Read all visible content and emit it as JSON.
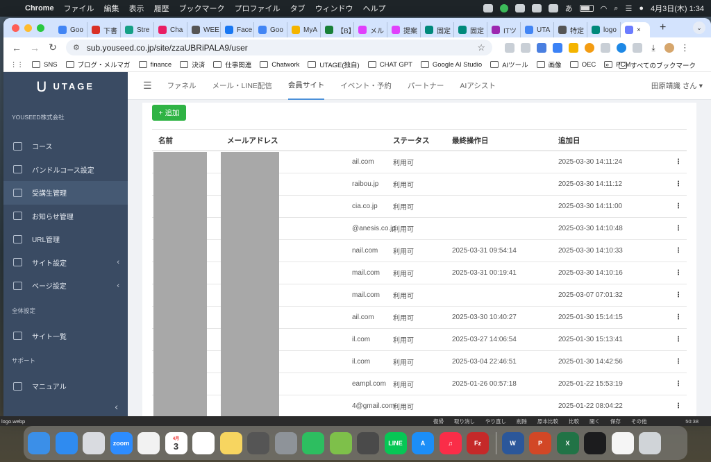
{
  "mac_menu": {
    "app": "Chrome",
    "items": [
      "ファイル",
      "編集",
      "表示",
      "履歴",
      "ブックマーク",
      "プロファイル",
      "タブ",
      "ウィンドウ",
      "ヘルプ"
    ],
    "ime": "あ",
    "datetime": "4月3日(木) 1:34"
  },
  "tabs": [
    {
      "label": "Goo",
      "color": "#4285f4"
    },
    {
      "label": "下書",
      "color": "#d93025"
    },
    {
      "label": "Stre",
      "color": "#16a085"
    },
    {
      "label": "Cha",
      "color": "#e91e63"
    },
    {
      "label": "WEE",
      "color": "#555555"
    },
    {
      "label": "Face",
      "color": "#1877f2"
    },
    {
      "label": "Goo",
      "color": "#4285f4"
    },
    {
      "label": "MyA",
      "color": "#f4b400"
    },
    {
      "label": "【B】",
      "color": "#188038"
    },
    {
      "label": "メル",
      "color": "#e040fb"
    },
    {
      "label": "提案",
      "color": "#e040fb"
    },
    {
      "label": "固定",
      "color": "#00897b"
    },
    {
      "label": "固定",
      "color": "#00897b"
    },
    {
      "label": "ITツ",
      "color": "#9c27b0"
    },
    {
      "label": "UTA",
      "color": "#4285f4"
    },
    {
      "label": "特定",
      "color": "#555555"
    },
    {
      "label": "logo",
      "color": "#00897b"
    }
  ],
  "active_tab_close": "×",
  "new_tab": "+",
  "address": {
    "url": "sub.youseed.co.jp/site/zzaUBRiPALA9/user"
  },
  "bookmarks": [
    "SNS",
    "ブログ・メルマガ",
    "finance",
    "決済",
    "仕事関連",
    "Chatwork",
    "UTAGE(独自)",
    "CHAT GPT",
    "Google AI Studio",
    "AIツール",
    "画像",
    "OEC",
    "PCM"
  ],
  "bookmarks_more": "»",
  "bookmarks_all": "すべてのブックマーク",
  "app": {
    "brand": "UTAGE",
    "org": "YOUSEED株式会社",
    "menu": [
      {
        "label": "コース",
        "icon": "book-icon"
      },
      {
        "label": "バンドルコース設定",
        "icon": "list-icon"
      },
      {
        "label": "受講生管理",
        "icon": "user-icon",
        "active": true
      },
      {
        "label": "お知らせ管理",
        "icon": "megaphone-icon"
      },
      {
        "label": "URL管理",
        "icon": "link-icon"
      },
      {
        "label": "サイト設定",
        "icon": "gear-icon",
        "submenu": true
      },
      {
        "label": "ページ設定",
        "icon": "page-icon",
        "submenu": true
      }
    ],
    "section_global": "全体設定",
    "global_menu": [
      {
        "label": "サイト一覧",
        "icon": "sitemap-icon"
      }
    ],
    "section_support": "サポート",
    "support_menu": [
      {
        "label": "マニュアル",
        "icon": "person-icon"
      }
    ],
    "collapse_icon": "‹",
    "topnav": [
      "ファネル",
      "メール・LINE配信",
      "会員サイト",
      "イベント・予約",
      "パートナー",
      "AIアシスト"
    ],
    "active_topnav": "会員サイト",
    "user_name": "田原靖識 さん ▾",
    "add_button": "+ 追加"
  },
  "table": {
    "headers": [
      "名前",
      "メールアドレス",
      "ステータス",
      "最終操作日",
      "追加日"
    ],
    "rows": [
      {
        "email": "ail.com",
        "status": "利用可",
        "last": "",
        "added": "2025-03-30 14:11:24"
      },
      {
        "email": "raibou.jp",
        "status": "利用可",
        "last": "",
        "added": "2025-03-30 14:11:12"
      },
      {
        "email": "cia.co.jp",
        "status": "利用可",
        "last": "",
        "added": "2025-03-30 14:11:00"
      },
      {
        "email": "@anesis.co.jp",
        "status": "利用可",
        "last": "",
        "added": "2025-03-30 14:10:48"
      },
      {
        "email": "nail.com",
        "status": "利用可",
        "last": "2025-03-31 09:54:14",
        "added": "2025-03-30 14:10:33"
      },
      {
        "email": "mail.com",
        "status": "利用可",
        "last": "2025-03-31 00:19:41",
        "added": "2025-03-30 14:10:16"
      },
      {
        "email": "mail.com",
        "status": "利用可",
        "last": "",
        "added": "2025-03-07 07:01:32"
      },
      {
        "email": "ail.com",
        "status": "利用可",
        "last": "2025-03-30 10:40:27",
        "added": "2025-01-30 15:14:15"
      },
      {
        "email": "il.com",
        "status": "利用可",
        "last": "2025-03-27 14:06:54",
        "added": "2025-01-30 15:13:41"
      },
      {
        "email": "il.com",
        "status": "利用可",
        "last": "2025-03-04 22:46:51",
        "added": "2025-01-30 14:42:56"
      },
      {
        "email": "eampl.com",
        "status": "利用可",
        "last": "2025-01-26 00:57:18",
        "added": "2025-01-22 15:53:19"
      },
      {
        "email": "4@gmail.com",
        "status": "利用可",
        "last": "",
        "added": "2025-01-22 08:04:22"
      }
    ],
    "row_menu": "⋮"
  },
  "bg_strip": {
    "filename": "logo.webp",
    "tools": [
      "復帰",
      "取り消し",
      "やり直し",
      "削除",
      "原本比較",
      "比較",
      "開く",
      "保存",
      "その他"
    ],
    "time": "50:38"
  },
  "dock": [
    {
      "name": "finder",
      "color": "#3b8fe8",
      "label": ""
    },
    {
      "name": "safari",
      "color": "#2f8bf0",
      "label": ""
    },
    {
      "name": "launchpad",
      "color": "#d9dbe0",
      "label": ""
    },
    {
      "name": "zoom",
      "color": "#2d8cff",
      "label": "zoom"
    },
    {
      "name": "photos",
      "color": "#f2f2f2",
      "label": ""
    },
    {
      "name": "calendar",
      "color": "#ffffff",
      "label": "3"
    },
    {
      "name": "chrome",
      "color": "#ffffff",
      "label": ""
    },
    {
      "name": "notes",
      "color": "#f7d560",
      "label": ""
    },
    {
      "name": "quicktime",
      "color": "#555555",
      "label": ""
    },
    {
      "name": "settings",
      "color": "#8e9399",
      "label": ""
    },
    {
      "name": "evernote",
      "color": "#2dbe60",
      "label": ""
    },
    {
      "name": "pixelmator",
      "color": "#7ec04a",
      "label": ""
    },
    {
      "name": "davinci",
      "color": "#4a4a4a",
      "label": ""
    },
    {
      "name": "line",
      "color": "#06c755",
      "label": "LINE"
    },
    {
      "name": "appstore",
      "color": "#1c8ef7",
      "label": "A"
    },
    {
      "name": "music",
      "color": "#fa2d48",
      "label": "♫"
    },
    {
      "name": "filezilla",
      "color": "#c52929",
      "label": "Fz"
    },
    {
      "name": "word",
      "color": "#2b579a",
      "label": "W"
    },
    {
      "name": "powerpoint",
      "color": "#d24726",
      "label": "P"
    },
    {
      "name": "excel",
      "color": "#217346",
      "label": "X"
    },
    {
      "name": "stocks",
      "color": "#1c1c1e",
      "label": ""
    },
    {
      "name": "textedit",
      "color": "#f5f5f5",
      "label": ""
    },
    {
      "name": "trash",
      "color": "#d0d4d8",
      "label": ""
    }
  ],
  "calendar_month": "4月"
}
